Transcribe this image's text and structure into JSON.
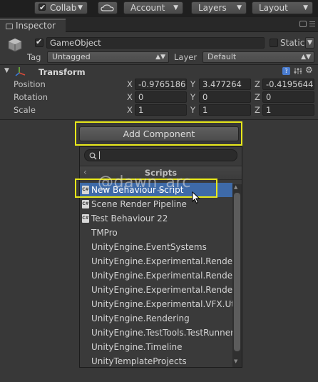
{
  "toolbar": {
    "collab": "Collab",
    "account": "Account",
    "layers": "Layers",
    "layout": "Layout",
    "cloud_icon": "cloud-icon"
  },
  "tab": {
    "label": "Inspector"
  },
  "gameobject": {
    "name": "GameObject",
    "active": true,
    "static_label": "Static",
    "tag_label": "Tag",
    "tag_value": "Untagged",
    "layer_label": "Layer",
    "layer_value": "Default"
  },
  "transform": {
    "title": "Transform",
    "rows": [
      {
        "label": "Position",
        "x": "-0.9765186",
        "y": "3.477264",
        "z": "-0.4195644"
      },
      {
        "label": "Rotation",
        "x": "0",
        "y": "0",
        "z": "0"
      },
      {
        "label": "Scale",
        "x": "1",
        "y": "1",
        "z": "1"
      }
    ],
    "axis": {
      "x": "X",
      "y": "Y",
      "z": "Z"
    }
  },
  "add_component": {
    "button": "Add Component",
    "search_value": "",
    "category": "Scripts",
    "items": [
      {
        "label": "New Behaviour Script",
        "icon": "cs-script-icon",
        "selected": true
      },
      {
        "label": "Scene Render Pipeline",
        "icon": "cs-script-icon"
      },
      {
        "label": "Test Behaviour 22",
        "icon": "cs-script-icon"
      },
      {
        "label": "TMPro"
      },
      {
        "label": "UnityEngine.EventSystems"
      },
      {
        "label": "UnityEngine.Experimental.Rendering"
      },
      {
        "label": "UnityEngine.Experimental.Rendering"
      },
      {
        "label": "UnityEngine.Experimental.Rendering"
      },
      {
        "label": "UnityEngine.Experimental.VFX.Utility"
      },
      {
        "label": "UnityEngine.Rendering"
      },
      {
        "label": "UnityEngine.TestTools.TestRunner"
      },
      {
        "label": "UnityEngine.Timeline"
      },
      {
        "label": "UnityTemplateProjects"
      }
    ]
  },
  "watermark": "@dawn_arc",
  "colors": {
    "selection": "#3e6aa8",
    "highlight": "#e8e81a",
    "panel": "#383838"
  }
}
